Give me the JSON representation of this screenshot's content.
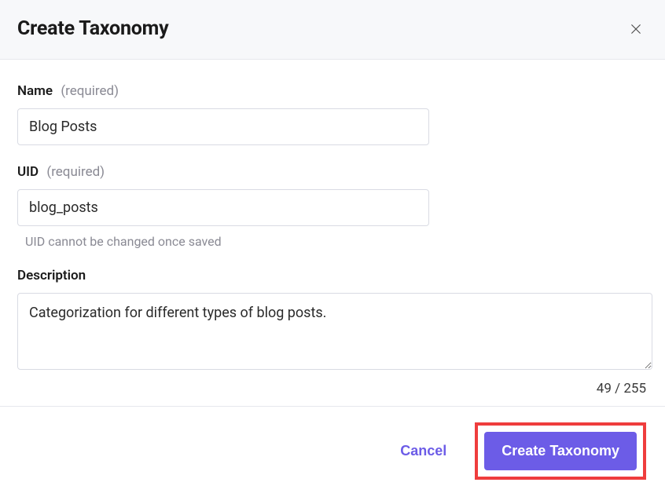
{
  "header": {
    "title": "Create Taxonomy"
  },
  "fields": {
    "name": {
      "label": "Name",
      "required_hint": "(required)",
      "value": "Blog Posts"
    },
    "uid": {
      "label": "UID",
      "required_hint": "(required)",
      "value": "blog_posts",
      "helper": "UID cannot be changed once saved"
    },
    "description": {
      "label": "Description",
      "value": "Categorization for different types of blog posts.",
      "char_count": "49 / 255"
    }
  },
  "footer": {
    "cancel_label": "Cancel",
    "submit_label": "Create Taxonomy"
  }
}
